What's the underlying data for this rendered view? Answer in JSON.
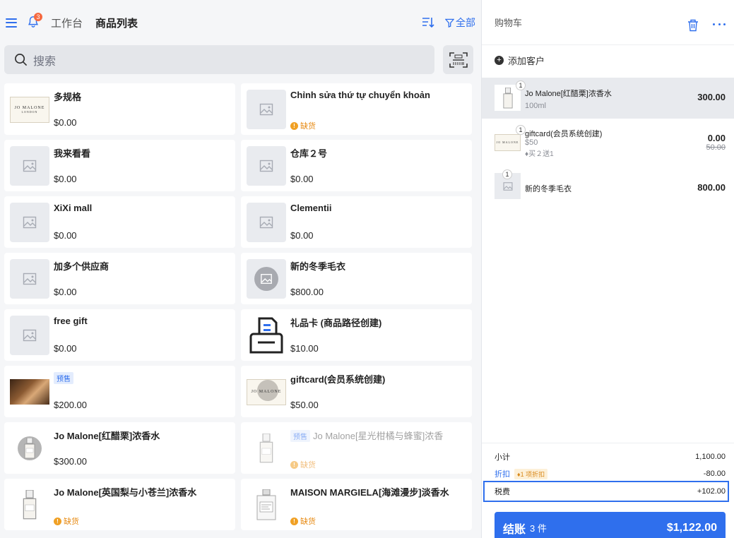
{
  "header": {
    "notification_count": "3",
    "tabs": [
      {
        "label": "工作台"
      },
      {
        "label": "商品列表"
      }
    ],
    "filter_label": "全部"
  },
  "search": {
    "placeholder": "搜索"
  },
  "products": [
    {
      "name": "多规格",
      "price": "$0.00"
    },
    {
      "name": "Chỉnh sửa thứ tự chuyển khoản",
      "status": "缺货"
    },
    {
      "name": "我来看看",
      "price": "$0.00"
    },
    {
      "name": "仓库２号",
      "price": "$0.00"
    },
    {
      "name": "XiXi mall",
      "price": "$0.00"
    },
    {
      "name": "Clementii",
      "price": "$0.00"
    },
    {
      "name": "加多个供应商",
      "price": "$0.00"
    },
    {
      "name": "新的冬季毛衣",
      "price": "$800.00"
    },
    {
      "name": "free gift",
      "price": "$0.00"
    },
    {
      "name": "礼品卡 (商品路径创建)",
      "price": "$10.00"
    },
    {
      "name": "",
      "tag": "预售",
      "price": "$200.00"
    },
    {
      "name": "giftcard(会员系统创建)",
      "price": "$50.00"
    },
    {
      "name": "Jo Malone[红醋栗]浓香水",
      "price": "$300.00"
    },
    {
      "name": "Jo Malone[星光柑橘与蜂蜜]浓香",
      "tag": "预售",
      "status": "缺货"
    },
    {
      "name": "Jo Malone[英国梨与小苍兰]浓香水",
      "status": "缺货"
    },
    {
      "name": "MAISON MARGIELA[海滩漫步]淡香水",
      "status": "缺货"
    }
  ],
  "cart": {
    "title": "购物车",
    "add_customer": "添加客户",
    "items": [
      {
        "qty": "1",
        "name": "Jo Malone[红醋栗]浓香水",
        "variant": "100ml",
        "price": "300.00"
      },
      {
        "qty": "1",
        "name": "giftcard(会员系统创建)",
        "variant": "$50",
        "promo": "买２送1",
        "price": "0.00",
        "original_price": "50.00"
      },
      {
        "qty": "1",
        "name": "新的冬季毛衣",
        "price": "800.00"
      }
    ],
    "summary": {
      "subtotal_label": "小计",
      "subtotal": "1,100.00",
      "discount_label": "折扣",
      "discount_tag": "1 项折扣",
      "discount": "-80.00",
      "tax_label": "税费",
      "tax": "+102.00"
    },
    "checkout": {
      "label": "结账",
      "count": "3 件",
      "total": "$1,122.00"
    }
  },
  "colors": {
    "accent": "#2f6fed",
    "warning": "#f0a024"
  },
  "icons": [
    "menu-icon",
    "bell-icon",
    "sort-icon",
    "filter-icon",
    "search-icon",
    "scan-icon",
    "trash-icon",
    "more-icon",
    "plus-icon",
    "image-placeholder-icon",
    "tag-icon",
    "printer-icon"
  ]
}
